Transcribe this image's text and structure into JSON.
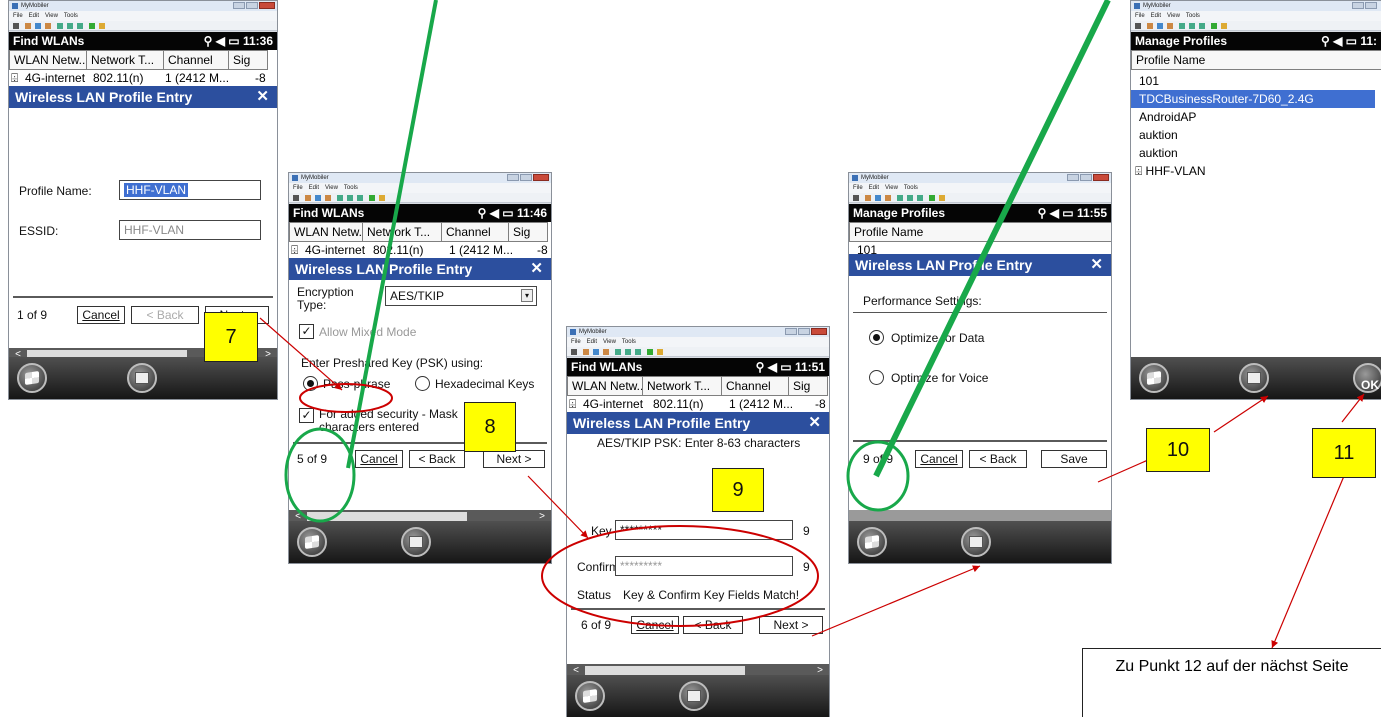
{
  "mymobiler": {
    "title": "MyMobiler",
    "menu": [
      "File",
      "Edit",
      "View",
      "Tools"
    ]
  },
  "s1": {
    "header": "Find WLANs",
    "clock": "11:36",
    "cols": [
      "WLAN Netw...",
      "Network T...",
      "Channel",
      "Sig"
    ],
    "row": {
      "name": "4G-internet",
      "type": "802.11(n)",
      "channel": "1 (2412 M...",
      "signal": "-8"
    },
    "dialog_title": "Wireless LAN Profile Entry",
    "profile_label": "Profile Name:",
    "profile_value": "HHF-VLAN",
    "essid_label": "ESSID:",
    "essid_value": "HHF-VLAN",
    "step": "1 of 9",
    "cancel": "Cancel",
    "back": "< Back",
    "next": "Next >"
  },
  "s2": {
    "header": "Find WLANs",
    "clock": "11:46",
    "cols": [
      "WLAN Netw...",
      "Network T...",
      "Channel",
      "Sig"
    ],
    "row": {
      "name": "4G-internet",
      "type": "802.11(n)",
      "channel": "1 (2412 M...",
      "signal": "-8"
    },
    "dialog_title": "Wireless LAN Profile Entry",
    "enc_label": "Encryption Type:",
    "enc_value": "AES/TKIP",
    "mixed": "Allow Mixed Mode",
    "psk_label": "Enter Preshared Key (PSK) using:",
    "passphrase": "Pass-phrase",
    "hex": "Hexadecimal Keys",
    "mask": "For added security - Mask characters entered",
    "step": "5 of 9",
    "cancel": "Cancel",
    "back": "< Back",
    "next": "Next >"
  },
  "s3": {
    "header": "Find WLANs",
    "clock": "11:51",
    "cols": [
      "WLAN Netw...",
      "Network T...",
      "Channel",
      "Sig"
    ],
    "row": {
      "name": "4G-internet",
      "type": "802.11(n)",
      "channel": "1 (2412 M...",
      "signal": "-8"
    },
    "dialog_title": "Wireless LAN Profile Entry",
    "hint": "AES/TKIP PSK: Enter 8-63 characters",
    "key_label": "Key",
    "key_value": "*********",
    "key_count": "9",
    "confirm_label": "Confirm",
    "confirm_value": "*********",
    "confirm_count": "9",
    "status_label": "Status",
    "status_value": "Key & Confirm Key Fields Match!",
    "step": "6 of 9",
    "cancel": "Cancel",
    "back": "< Back",
    "next": "Next >"
  },
  "s4": {
    "header": "Manage Profiles",
    "clock": "11:55",
    "col": "Profile Name",
    "first": "101",
    "dialog_title": "Wireless LAN Profile Entry",
    "perf_label": "Performance Settings:",
    "opt_data": "Optimize for Data",
    "opt_voice": "Optimize for Voice",
    "step": "9 of 9",
    "cancel": "Cancel",
    "back": "< Back",
    "save": "Save"
  },
  "s5": {
    "header": "Manage Profiles",
    "clock": "11:",
    "col": "Profile Name",
    "profiles": [
      "101",
      "TDCBusinessRouter-7D60_2.4G",
      "AndroidAP",
      "auktion",
      "auktion",
      "HHF-VLAN"
    ],
    "ok": "OK"
  },
  "annotations": {
    "n7": "7",
    "n8": "8",
    "n9": "9",
    "n10": "10",
    "n11": "11",
    "note": "Zu Punkt 12 auf der nächst Seite"
  },
  "colors": {
    "dialog": "#2c4f9e",
    "highlight": "#3f6fd1",
    "arrow_red": "#cc0000",
    "green": "#18a84a",
    "callout": "#ffff00"
  }
}
